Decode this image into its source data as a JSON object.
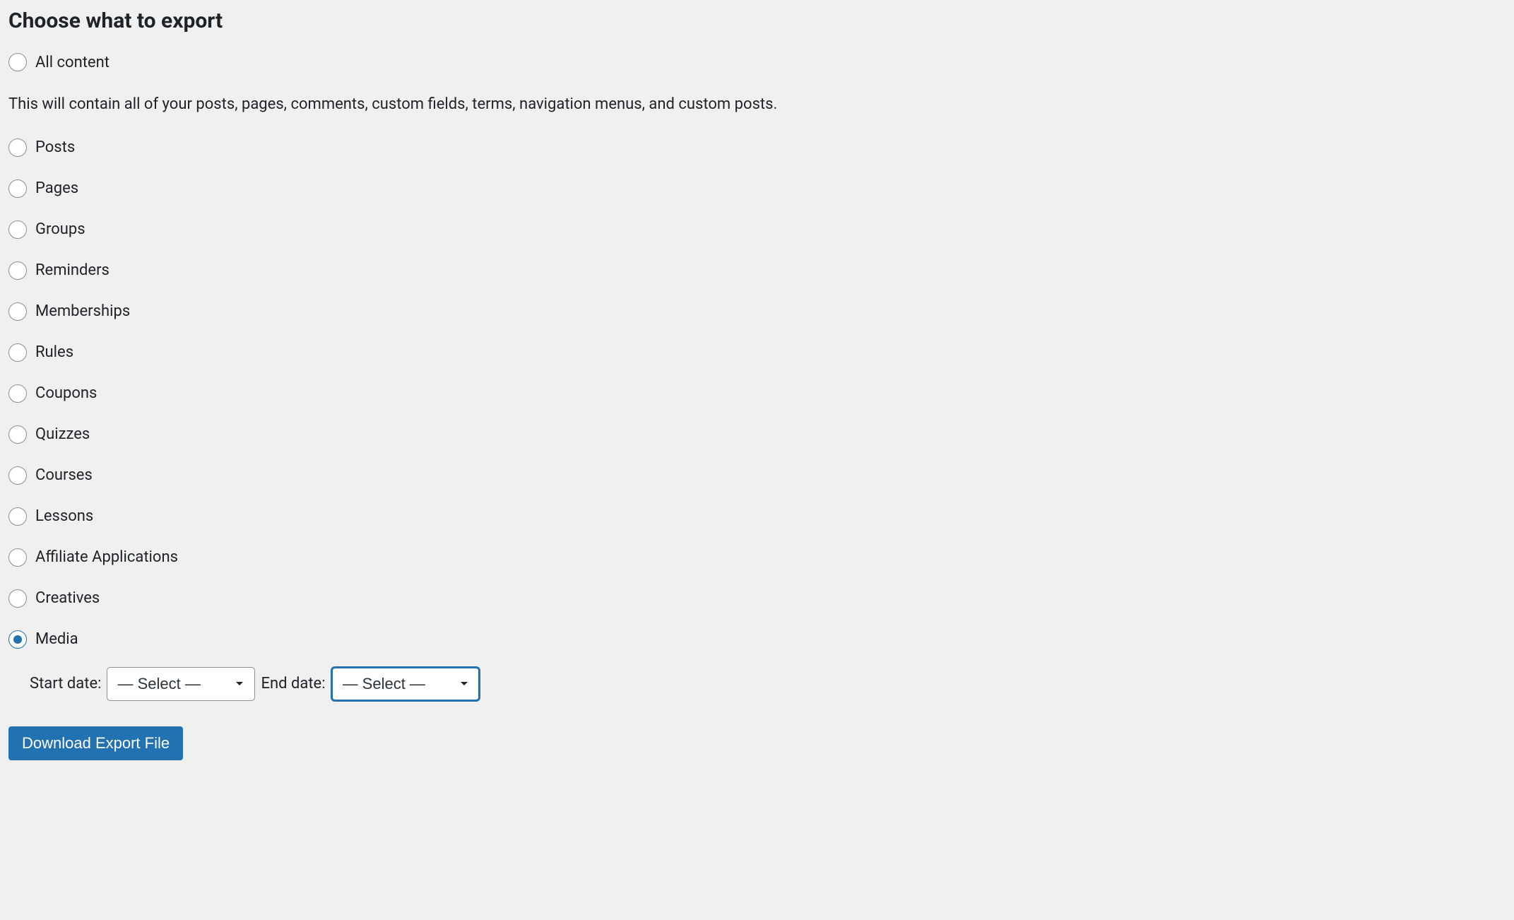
{
  "heading": "Choose what to export",
  "options": {
    "all_content": "All content",
    "all_content_desc": "This will contain all of your posts, pages, comments, custom fields, terms, navigation menus, and custom posts.",
    "posts": "Posts",
    "pages": "Pages",
    "groups": "Groups",
    "reminders": "Reminders",
    "memberships": "Memberships",
    "rules": "Rules",
    "coupons": "Coupons",
    "quizzes": "Quizzes",
    "courses": "Courses",
    "lessons": "Lessons",
    "affiliate_applications": "Affiliate Applications",
    "creatives": "Creatives",
    "media": "Media"
  },
  "date_filters": {
    "start_label": "Start date:",
    "end_label": "End date:",
    "select_placeholder": "— Select —"
  },
  "download_button": "Download Export File"
}
